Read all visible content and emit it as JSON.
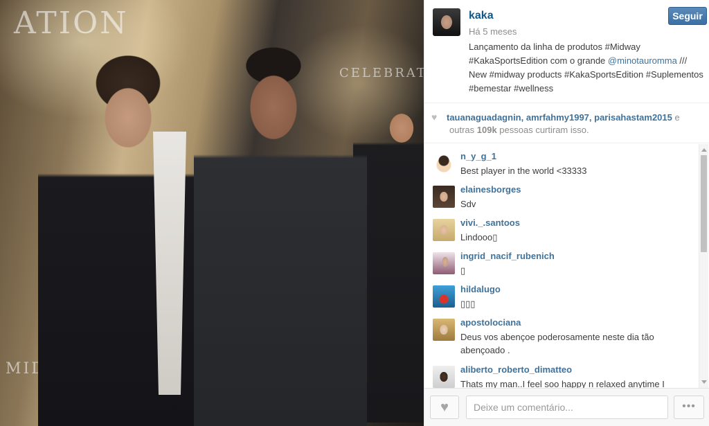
{
  "post": {
    "username": "kaka",
    "timestamp": "Há 5 meses",
    "follow_label": "Seguir",
    "caption": {
      "part1": "Lançamento da linha de produtos #Midway #KakaSportsEdition com o grande ",
      "mention": "@minotauromma",
      "part2": " /// New #midway products #KakaSportsEdition #Suplementos #bemestar #wellness"
    }
  },
  "likes": {
    "heart_icon": "heart-icon",
    "names": "tauanaguadagnin, amrfahmy1997, parisahastam2015",
    "conj": " e",
    "prefix": "outras ",
    "count": "109k",
    "suffix": " pessoas curtiram isso."
  },
  "comments": [
    {
      "user": "n_y_g_1",
      "text": "Best player in the world <33333",
      "avatar_color": "#f2e6c8"
    },
    {
      "user": "elainesborges",
      "text": "Sdv",
      "avatar_color": "#4a3a2e"
    },
    {
      "user": "vivi._.santoos",
      "text": "Lindooo▯",
      "avatar_color": "#d9c29a"
    },
    {
      "user": "ingrid_nacif_rubenich",
      "text": "▯",
      "avatar_color": "#6b3f52"
    },
    {
      "user": "hildalugo",
      "text": "▯▯▯",
      "avatar_color": "#1f6fa6"
    },
    {
      "user": "apostolociana",
      "text": "Deus vos abençoe poderosamente neste dia tão abençoado .",
      "avatar_color": "#c9a46a"
    },
    {
      "user": "aliberto_roberto_dimatteo",
      "text": "Thats my man..I feel soo happy n relaxed anytime I",
      "avatar_color": "#2b2b2b"
    }
  ],
  "footer": {
    "comment_placeholder": "Deixe um comentário...",
    "like_icon": "heart-icon",
    "more_icon": "more-options-icon",
    "more_label": "•••"
  },
  "colors": {
    "link": "#3f729b",
    "username": "#125688",
    "follow_button": "#3c70a4"
  }
}
